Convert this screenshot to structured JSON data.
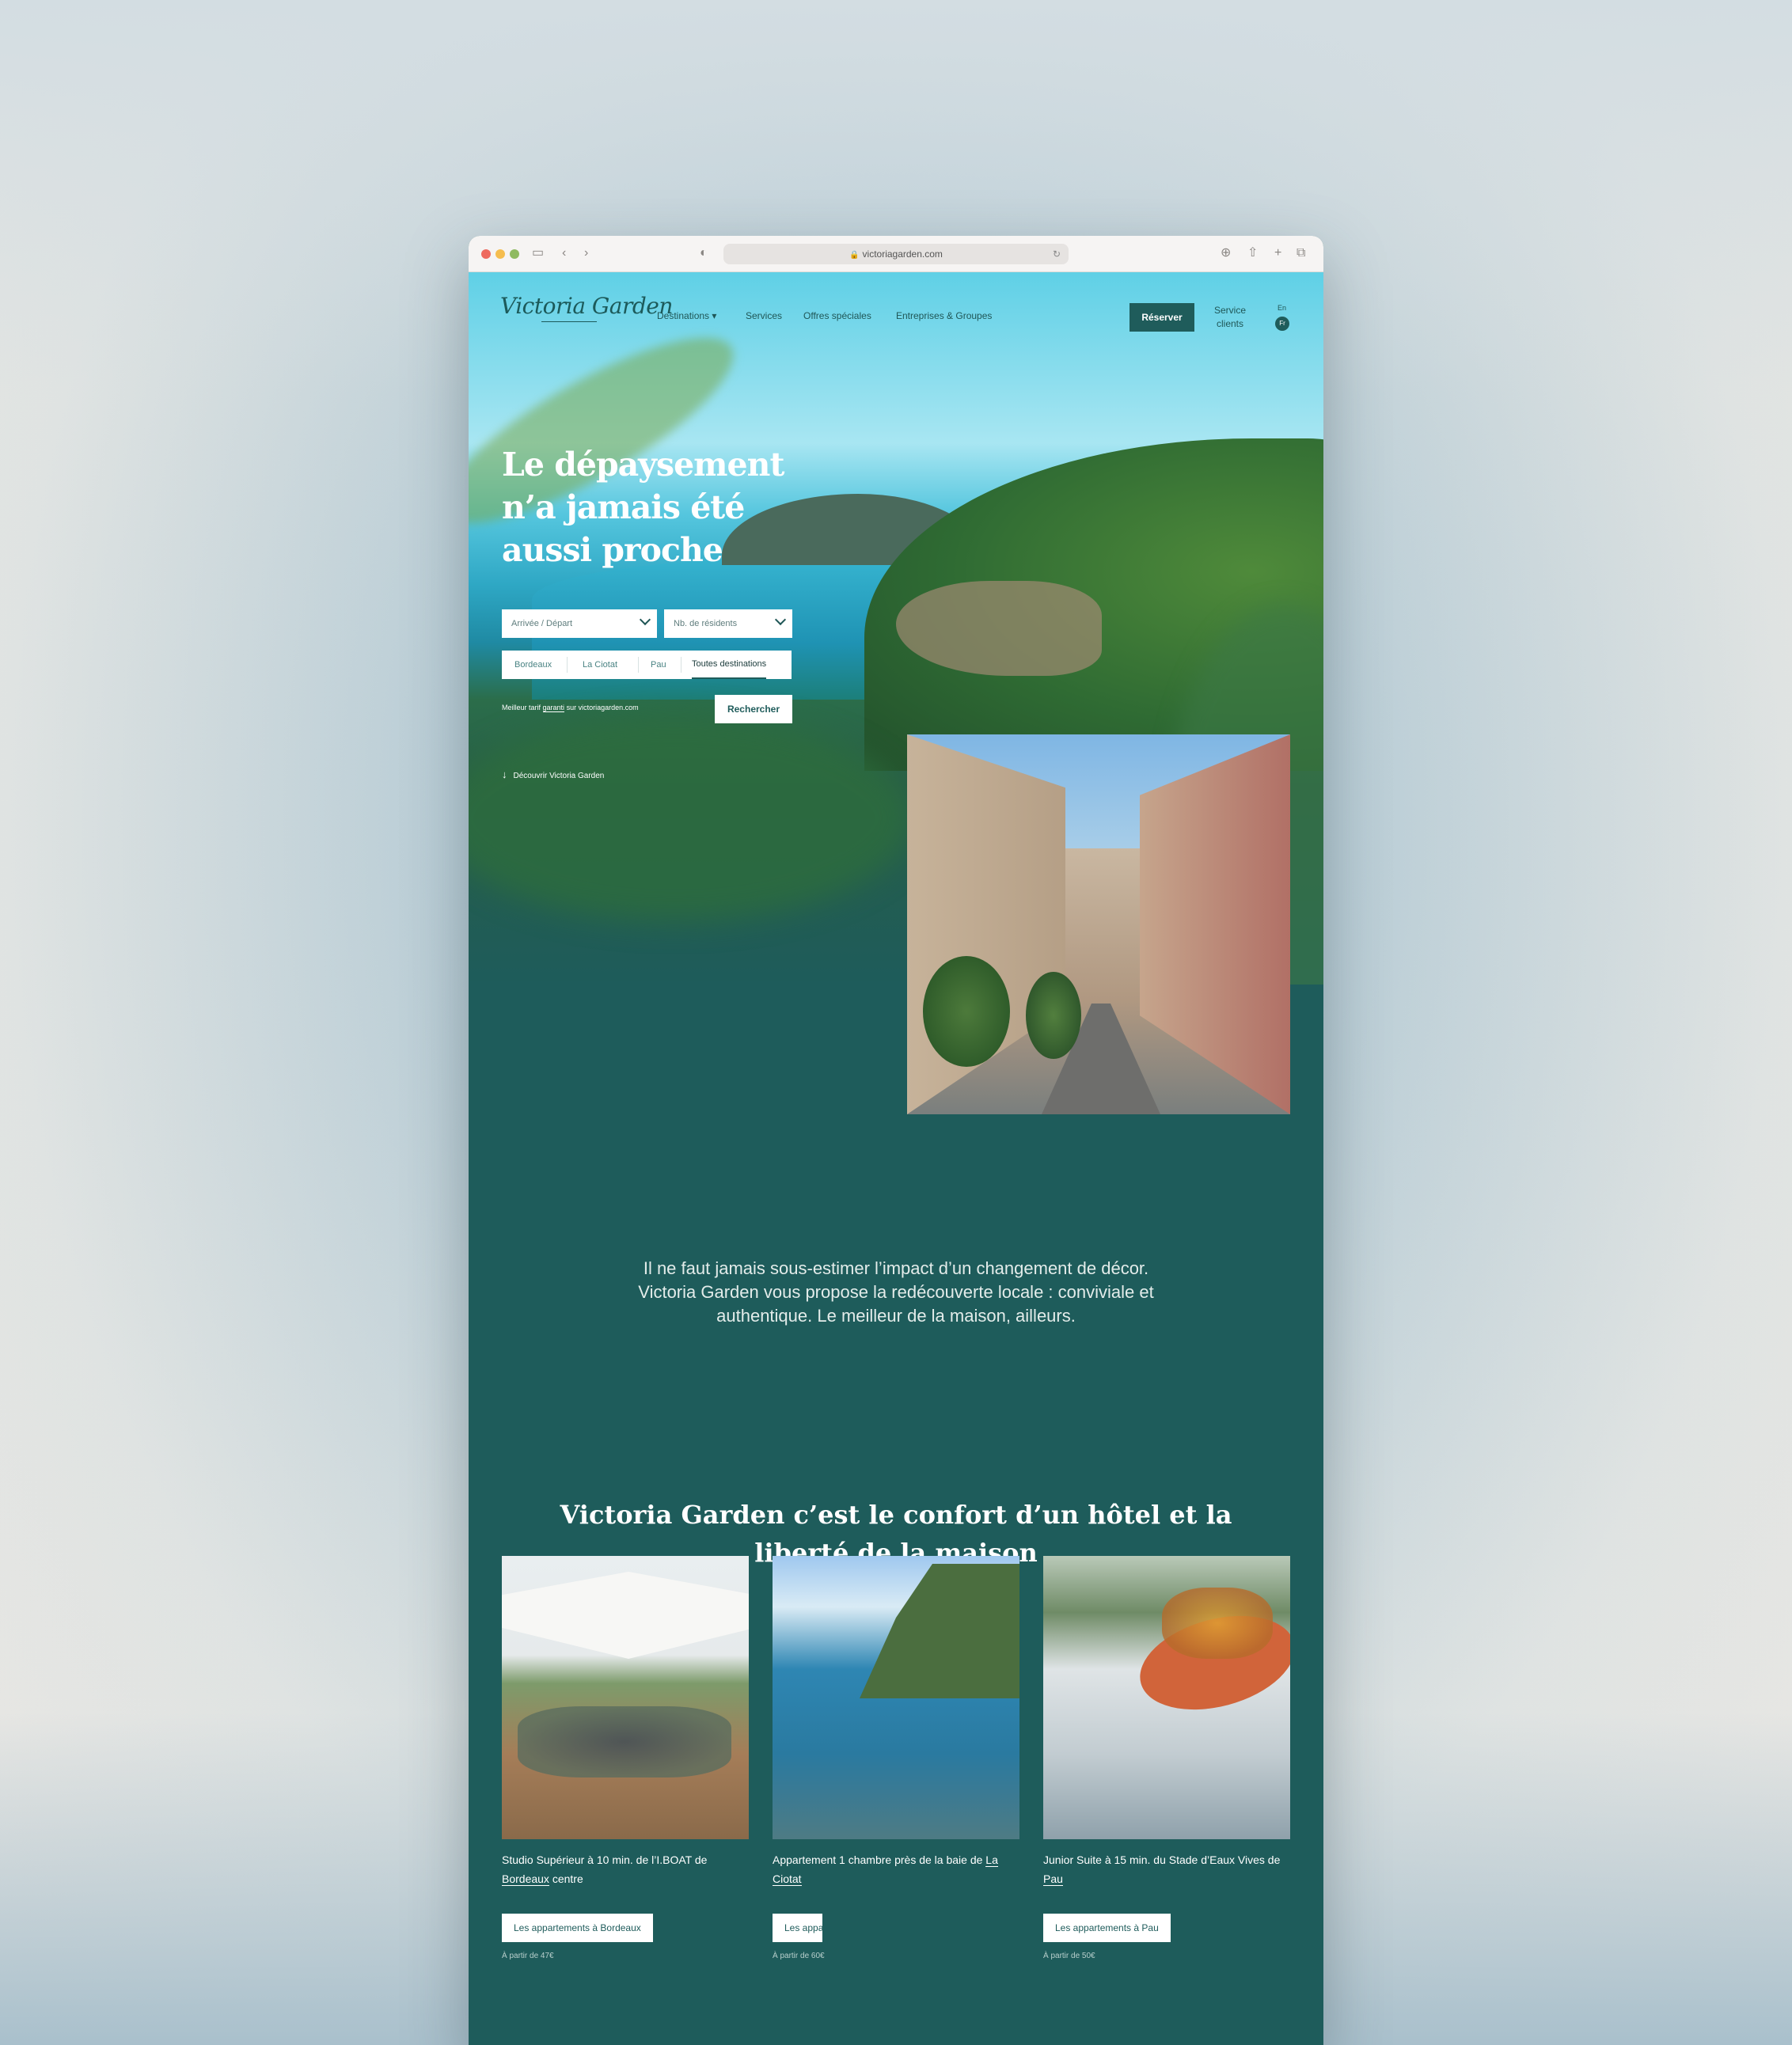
{
  "browser": {
    "url": "victoriagarden.com"
  },
  "nav": {
    "logo": "Victoria Garden",
    "items": [
      "Destinations",
      "Services",
      "Offres spéciales",
      "Entreprises & Groupes"
    ],
    "reserve_label": "Réserver",
    "service_label": "Service clients",
    "lang_en": "En",
    "lang_fr": "Fr"
  },
  "hero": {
    "title": "Le dépaysement n’a jamais été aussi proche",
    "dates_placeholder": "Arrivée / Départ",
    "residents_placeholder": "Nb. de résidents",
    "destinations": [
      "Bordeaux",
      "La Ciotat",
      "Pau",
      "Toutes destinations"
    ],
    "selected_destination": "Toutes destinations",
    "tarif_prefix": "Meilleur tarif",
    "tarif_link": "garanti",
    "tarif_suffix": "sur victoriagarden.com",
    "search_label": "Rechercher",
    "discover_label": "Découvrir Victoria Garden"
  },
  "intro": {
    "text": "Il ne faut jamais sous-estimer l’impact d’un changement de décor. Victoria Garden vous propose la redécouverte locale : conviviale et authentique. Le meilleur de la maison, ailleurs."
  },
  "section": {
    "title": "Victoria Garden c’est le confort d’un hôtel et la liberté de la maison"
  },
  "cards": [
    {
      "title_prefix": "Studio Supérieur à 10 min. de l’I.BOAT de",
      "city": "Bordeaux",
      "title_suffix": "centre",
      "button": "Les appartements à Bordeaux",
      "price": "À partir de 47€"
    },
    {
      "title_prefix": "Appartement 1 chambre près de la baie de",
      "city": "La Ciotat",
      "title_suffix": "",
      "button": "Les appartements à La Ciotat",
      "price": "À partir de 60€"
    },
    {
      "title_prefix": "Junior Suite à 15 min. du Stade d’Eaux Vives de",
      "city": "Pau",
      "title_suffix": "",
      "button": "Les appartements à Pau",
      "price": "À partir de 50€"
    }
  ],
  "colors": {
    "brand": "#1f5c5b",
    "page_bg": "#1e5c5b"
  }
}
